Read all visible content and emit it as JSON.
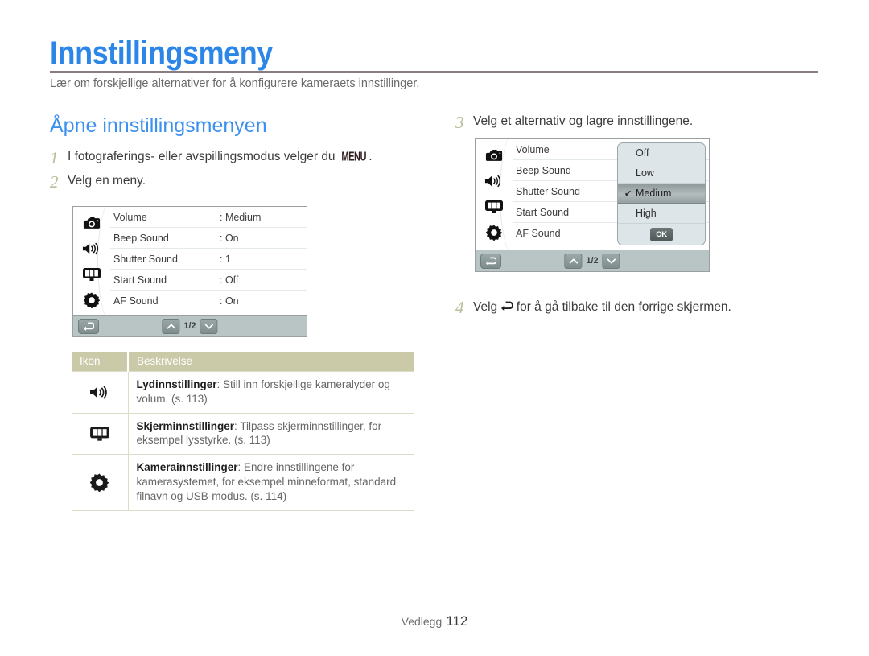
{
  "document": {
    "title": "Innstillingsmeny",
    "subtitle": "Lær om forskjellige alternativer for å konfigurere kameraets innstillinger.",
    "section_heading": "Åpne innstillingsmenyen",
    "footer_label": "Vedlegg",
    "footer_page": "112",
    "accent_color": "#3c90ee",
    "title_color": "#2b86e8",
    "step_number_color": "#b9bd9a",
    "table_header_color": "#cacaa8"
  },
  "steps": [
    {
      "number": "1",
      "text_before": "I fotograferings- eller avspillingsmodus velger du ",
      "inline_glyph": "MENU",
      "text_after": "."
    },
    {
      "number": "2",
      "text_before": "Velg en meny.",
      "inline_glyph": "",
      "text_after": ""
    },
    {
      "number": "3",
      "text_before": "Velg et alternativ og lagre innstillingene.",
      "inline_glyph": "",
      "text_after": ""
    },
    {
      "number": "4",
      "text_before": "Velg ",
      "inline_glyph": "back-arrow-icon",
      "text_after": " for å gå tilbake til den forrige skjermen."
    }
  ],
  "camera_screen_1": {
    "rail_icons": [
      "camera-icon",
      "speaker-icon",
      "display-icon",
      "gear-icon"
    ],
    "rows": [
      {
        "label": "Volume",
        "value": ": Medium"
      },
      {
        "label": "Beep Sound",
        "value": ": On"
      },
      {
        "label": "Shutter Sound",
        "value": ": 1"
      },
      {
        "label": "Start Sound",
        "value": ": Off"
      },
      {
        "label": "AF Sound",
        "value": ": On"
      }
    ],
    "bottom_bar": {
      "back_glyph": "↰",
      "up_glyph": "^",
      "down_glyph": "v",
      "page_indicator": "1/2"
    }
  },
  "camera_screen_2": {
    "rail_icons": [
      "camera-icon",
      "speaker-icon",
      "display-icon",
      "gear-icon"
    ],
    "rows": [
      {
        "label": "Volume",
        "value": ""
      },
      {
        "label": "Beep Sound",
        "value": ""
      },
      {
        "label": "Shutter Sound",
        "value": ""
      },
      {
        "label": "Start Sound",
        "value": ""
      },
      {
        "label": "AF Sound",
        "value": ""
      }
    ],
    "dropdown": {
      "options": [
        {
          "label": "Off",
          "selected": false,
          "check": ""
        },
        {
          "label": "Low",
          "selected": false,
          "check": ""
        },
        {
          "label": "Medium",
          "selected": true,
          "check": "✔"
        },
        {
          "label": "High",
          "selected": false,
          "check": ""
        }
      ],
      "ok_label": "OK"
    },
    "bottom_bar": {
      "back_glyph": "↰",
      "up_glyph": "^",
      "down_glyph": "v",
      "page_indicator": "1/2"
    }
  },
  "icon_table": {
    "headers": {
      "icon": "Ikon",
      "description": "Beskrivelse"
    },
    "rows": [
      {
        "icon": "speaker-icon",
        "term": "Lydinnstillinger",
        "description": ": Still inn forskjellige kameralyder og volum. (s. 113)"
      },
      {
        "icon": "display-icon",
        "term": "Skjerminnstillinger",
        "description": ": Tilpass skjerminnstillinger, for eksempel lysstyrke. (s. 113)"
      },
      {
        "icon": "gear-icon",
        "term": "Kamerainnstillinger",
        "description": ": Endre innstillingene for kamerasystemet, for eksempel minneformat, standard filnavn og USB-modus. (s. 114)"
      }
    ]
  }
}
